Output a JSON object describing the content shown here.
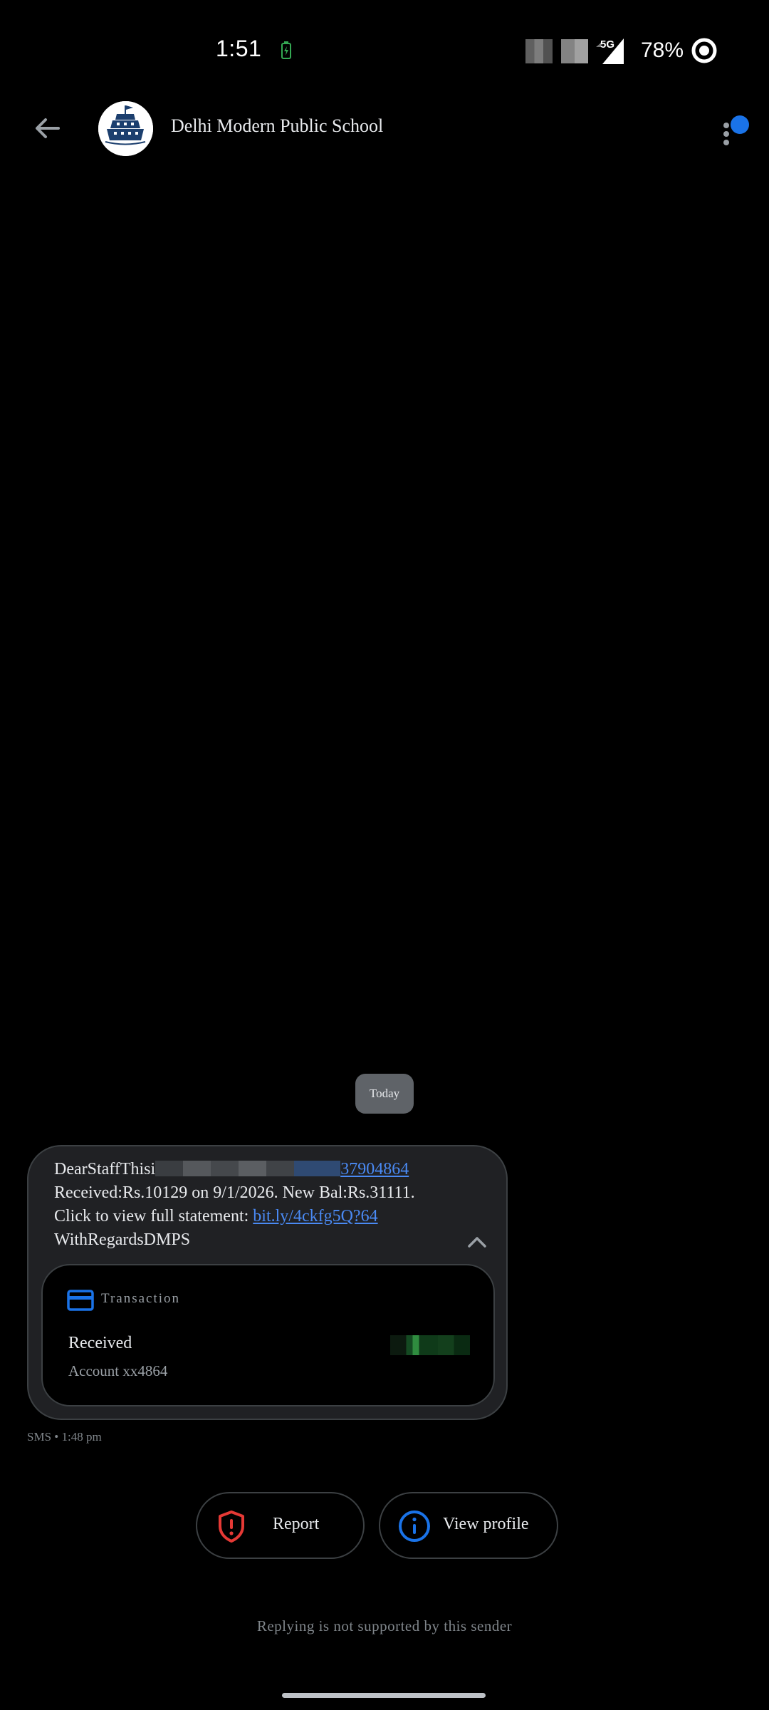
{
  "status_bar": {
    "time": "1:51",
    "network": "5G",
    "battery_percent": "78%"
  },
  "header": {
    "contact_name": "Delhi Modern Public School"
  },
  "conversation": {
    "date_chip": "Today",
    "message": {
      "line1_prefix": "DearStaffThisi",
      "line1_link_tail": "37904864",
      "line2": "Received:Rs.10129 on 9/1/2026. New Bal:Rs.31111.",
      "line3_prefix": "Click to view full statement: ",
      "line3_link": "bit.ly/4ckfg5Q?64",
      "line4": "WithRegardsDMPS"
    },
    "card": {
      "label": "Transaction",
      "title": "Received",
      "account": "Account xx4864"
    },
    "meta": "SMS • 1:48 pm"
  },
  "actions": {
    "report_label": "Report",
    "view_profile_label": "View profile"
  },
  "footer": {
    "reply_note": "Replying is not supported by this sender"
  },
  "colors": {
    "background": "#000000",
    "accent_blue": "#1a73e8",
    "report_red": "#e53935",
    "bubble": "#202124"
  }
}
